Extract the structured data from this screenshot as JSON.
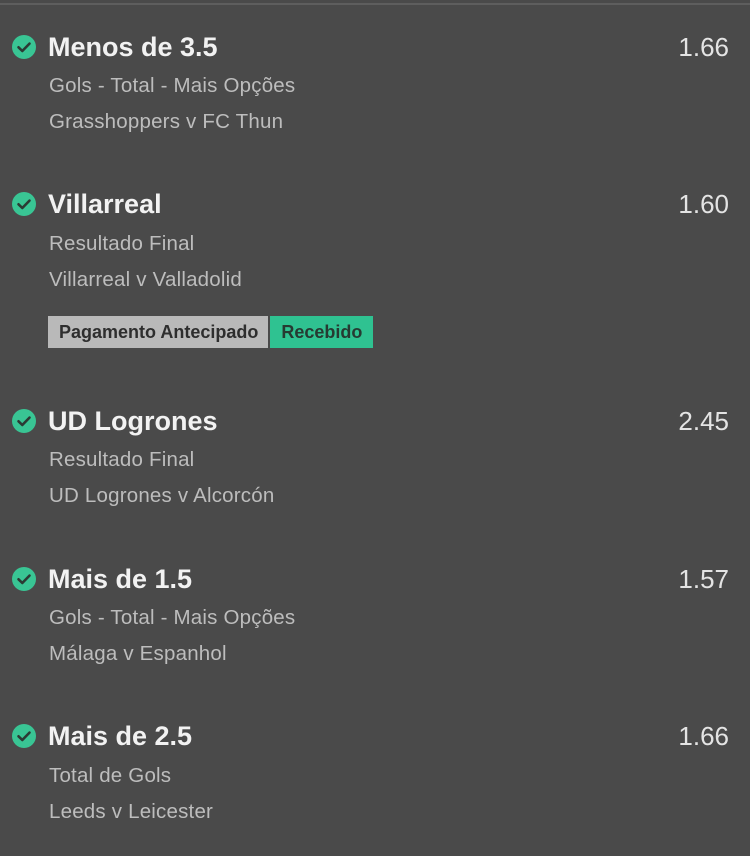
{
  "selections": [
    {
      "name": "Menos de 3.5",
      "odds": "1.66",
      "market": "Gols - Total - Mais Opções",
      "event": "Grasshoppers v FC Thun"
    },
    {
      "name": "Villarreal",
      "odds": "1.60",
      "market": "Resultado Final",
      "event": "Villarreal v Valladolid",
      "badges": {
        "early_payout": "Pagamento Antecipado",
        "received": "Recebido"
      }
    },
    {
      "name": "UD Logrones",
      "odds": "2.45",
      "market": "Resultado Final",
      "event": "UD Logrones v Alcorcón"
    },
    {
      "name": "Mais de 1.5",
      "odds": "1.57",
      "market": "Gols - Total - Mais Opções",
      "event": "Málaga v Espanhol"
    },
    {
      "name": "Mais de 2.5",
      "odds": "1.66",
      "market": "Total de Gols",
      "event": "Leeds v Leicester"
    }
  ],
  "colors": {
    "background": "#4a4a4a",
    "win_check": "#39c594",
    "received_badge": "#2fc291",
    "early_payout_badge": "#b9b9b9"
  },
  "icons": {
    "status": "check-circle-icon"
  }
}
